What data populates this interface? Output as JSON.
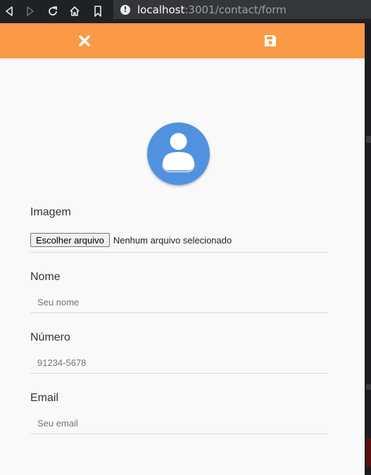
{
  "browser": {
    "url_host": "localhost",
    "url_rest": ":3001/contact/form"
  },
  "toolbar": {
    "close_icon": "close-icon",
    "save_icon": "floppy-disk-icon",
    "accent": "#fa9a46"
  },
  "avatar": {
    "icon": "user-avatar-icon",
    "color": "#5092e0"
  },
  "form": {
    "image": {
      "label": "Imagem",
      "button_label": "Escolher arquivo",
      "status": "Nenhum arquivo selecionado"
    },
    "name": {
      "label": "Nome",
      "placeholder": "Seu nome",
      "value": ""
    },
    "number": {
      "label": "Número",
      "placeholder": "91234-5678",
      "value": ""
    },
    "email": {
      "label": "Email",
      "placeholder": "Seu email",
      "value": ""
    }
  }
}
